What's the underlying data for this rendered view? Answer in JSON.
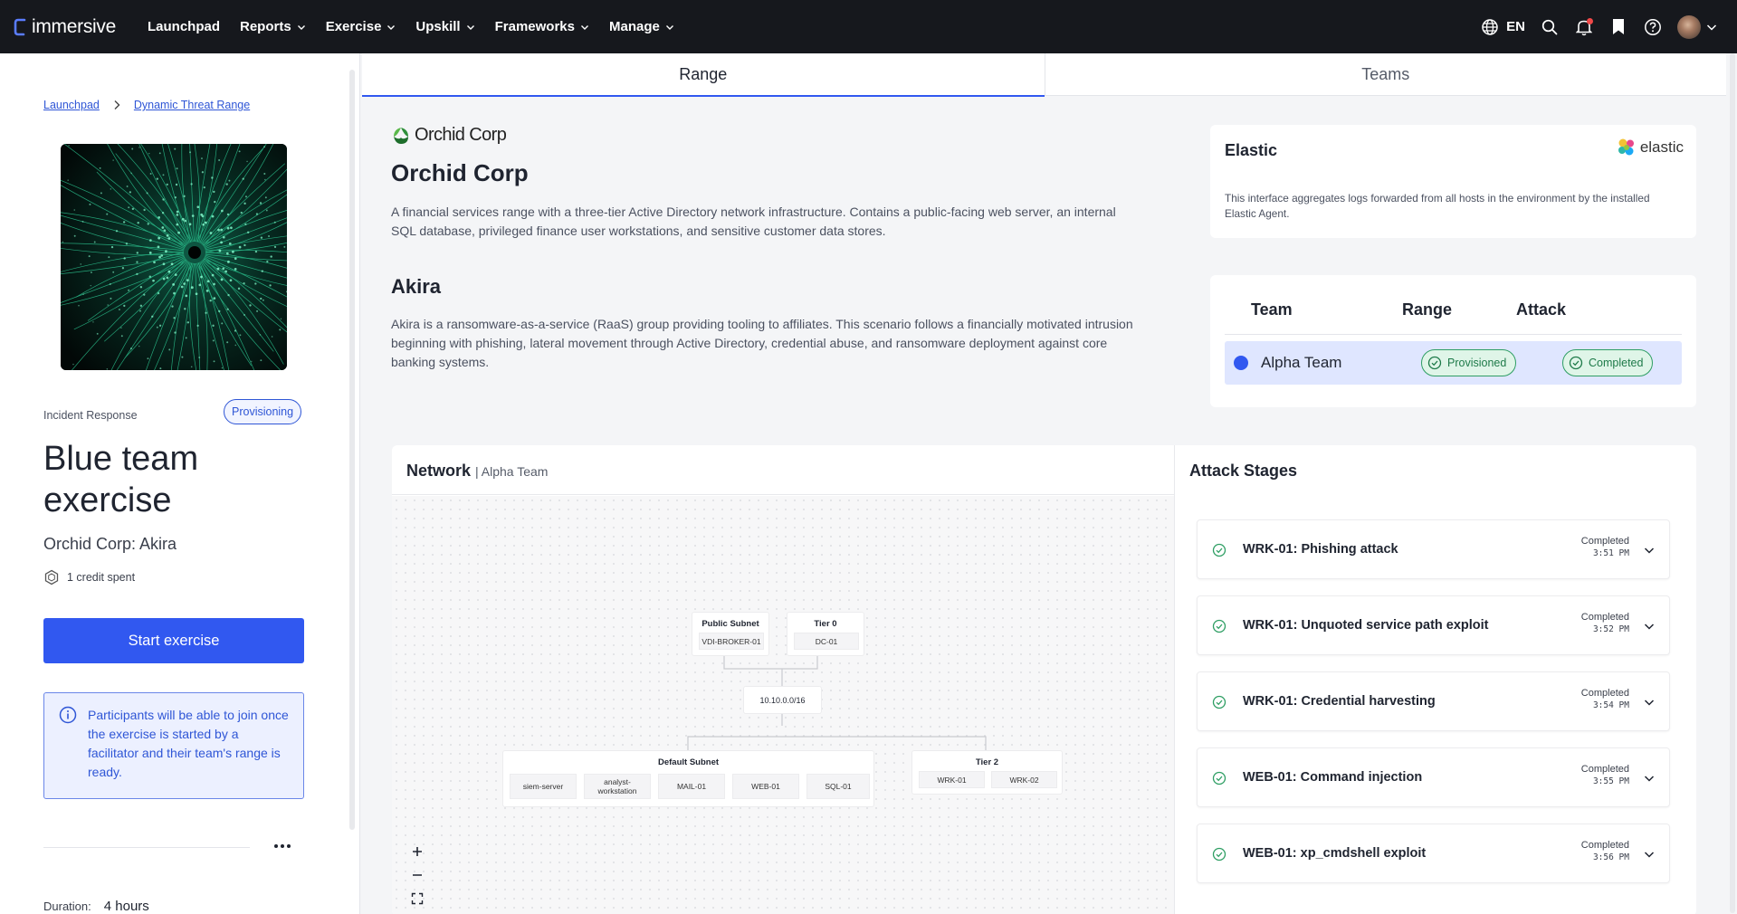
{
  "nav": {
    "brand": "immersive",
    "items": [
      {
        "label": "Launchpad",
        "has_menu": false
      },
      {
        "label": "Reports",
        "has_menu": true
      },
      {
        "label": "Exercise",
        "has_menu": true
      },
      {
        "label": "Upskill",
        "has_menu": true
      },
      {
        "label": "Frameworks",
        "has_menu": true
      },
      {
        "label": "Manage",
        "has_menu": true
      }
    ],
    "language": "EN",
    "icons": [
      "globe-icon",
      "search-icon",
      "bell-icon",
      "bookmark-icon",
      "help-icon",
      "avatar"
    ]
  },
  "sidebar": {
    "breadcrumb": [
      "Launchpad",
      "Dynamic Threat Range"
    ],
    "category": "Incident Response",
    "status_badge": "Provisioning",
    "title": "Blue team exercise",
    "subtitle": "Orchid Corp: Akira",
    "credits": "1 credit spent",
    "start_button": "Start exercise",
    "info_message": "Participants will be able to join once the exercise is started by a facilitator and their team's range is ready.",
    "duration_label": "Duration:",
    "duration_value": "4 hours"
  },
  "tabs": [
    {
      "label": "Range",
      "active": true
    },
    {
      "label": "Teams",
      "active": false
    }
  ],
  "organization": {
    "logo_text": "Orchid Corp",
    "name": "Orchid Corp",
    "description": "A financial services range with a three-tier Active Directory network infrastructure. Contains a public-facing web server, an internal SQL database, privileged finance user workstations, and sensitive customer data stores."
  },
  "scenario": {
    "name": "Akira",
    "description": "Akira is a ransomware-as-a-service (RaaS) group providing tooling to affiliates. This scenario follows a financially motivated intrusion beginning with phishing, lateral movement through Active Directory, credential abuse, and ransomware deployment against core banking systems."
  },
  "elastic": {
    "title": "Elastic",
    "logo_text": "elastic",
    "description": "This interface aggregates logs forwarded from all hosts in the environment by the installed Elastic Agent."
  },
  "teams_table": {
    "headers": [
      "Team",
      "Range",
      "Attack"
    ],
    "rows": [
      {
        "team": "Alpha Team",
        "range": "Provisioned",
        "attack": "Completed",
        "color": "#3158f0"
      }
    ]
  },
  "network": {
    "title": "Network",
    "team": "| Alpha Team",
    "subnets": {
      "public": {
        "label": "Public Subnet",
        "hosts": [
          "VDI-BROKER-01"
        ]
      },
      "tier0": {
        "label": "Tier 0",
        "hosts": [
          "DC-01"
        ]
      },
      "cidr": "10.10.0.0/16",
      "default": {
        "label": "Default Subnet",
        "hosts": [
          "siem-server",
          "analyst-workstation",
          "MAIL-01",
          "WEB-01",
          "SQL-01"
        ]
      },
      "tier2": {
        "label": "Tier 2",
        "hosts": [
          "WRK-01",
          "WRK-02"
        ]
      }
    },
    "zoom_controls": [
      "zoom-in",
      "zoom-out",
      "fit-view"
    ]
  },
  "attack_stages": {
    "title": "Attack Stages",
    "items": [
      {
        "name": "WRK-01: Phishing attack",
        "status": "Completed",
        "time": "3:51 PM"
      },
      {
        "name": "WRK-01: Unquoted service path exploit",
        "status": "Completed",
        "time": "3:52 PM"
      },
      {
        "name": "WRK-01: Credential harvesting",
        "status": "Completed",
        "time": "3:54 PM"
      },
      {
        "name": "WEB-01: Command injection",
        "status": "Completed",
        "time": "3:55 PM"
      },
      {
        "name": "WEB-01: xp_cmdshell exploit",
        "status": "Completed",
        "time": "3:56 PM"
      }
    ]
  },
  "colors": {
    "accent": "#3158f0",
    "nav_bg": "#16181d",
    "success": "#2e9e63",
    "team_row": "#dfe6ff"
  }
}
